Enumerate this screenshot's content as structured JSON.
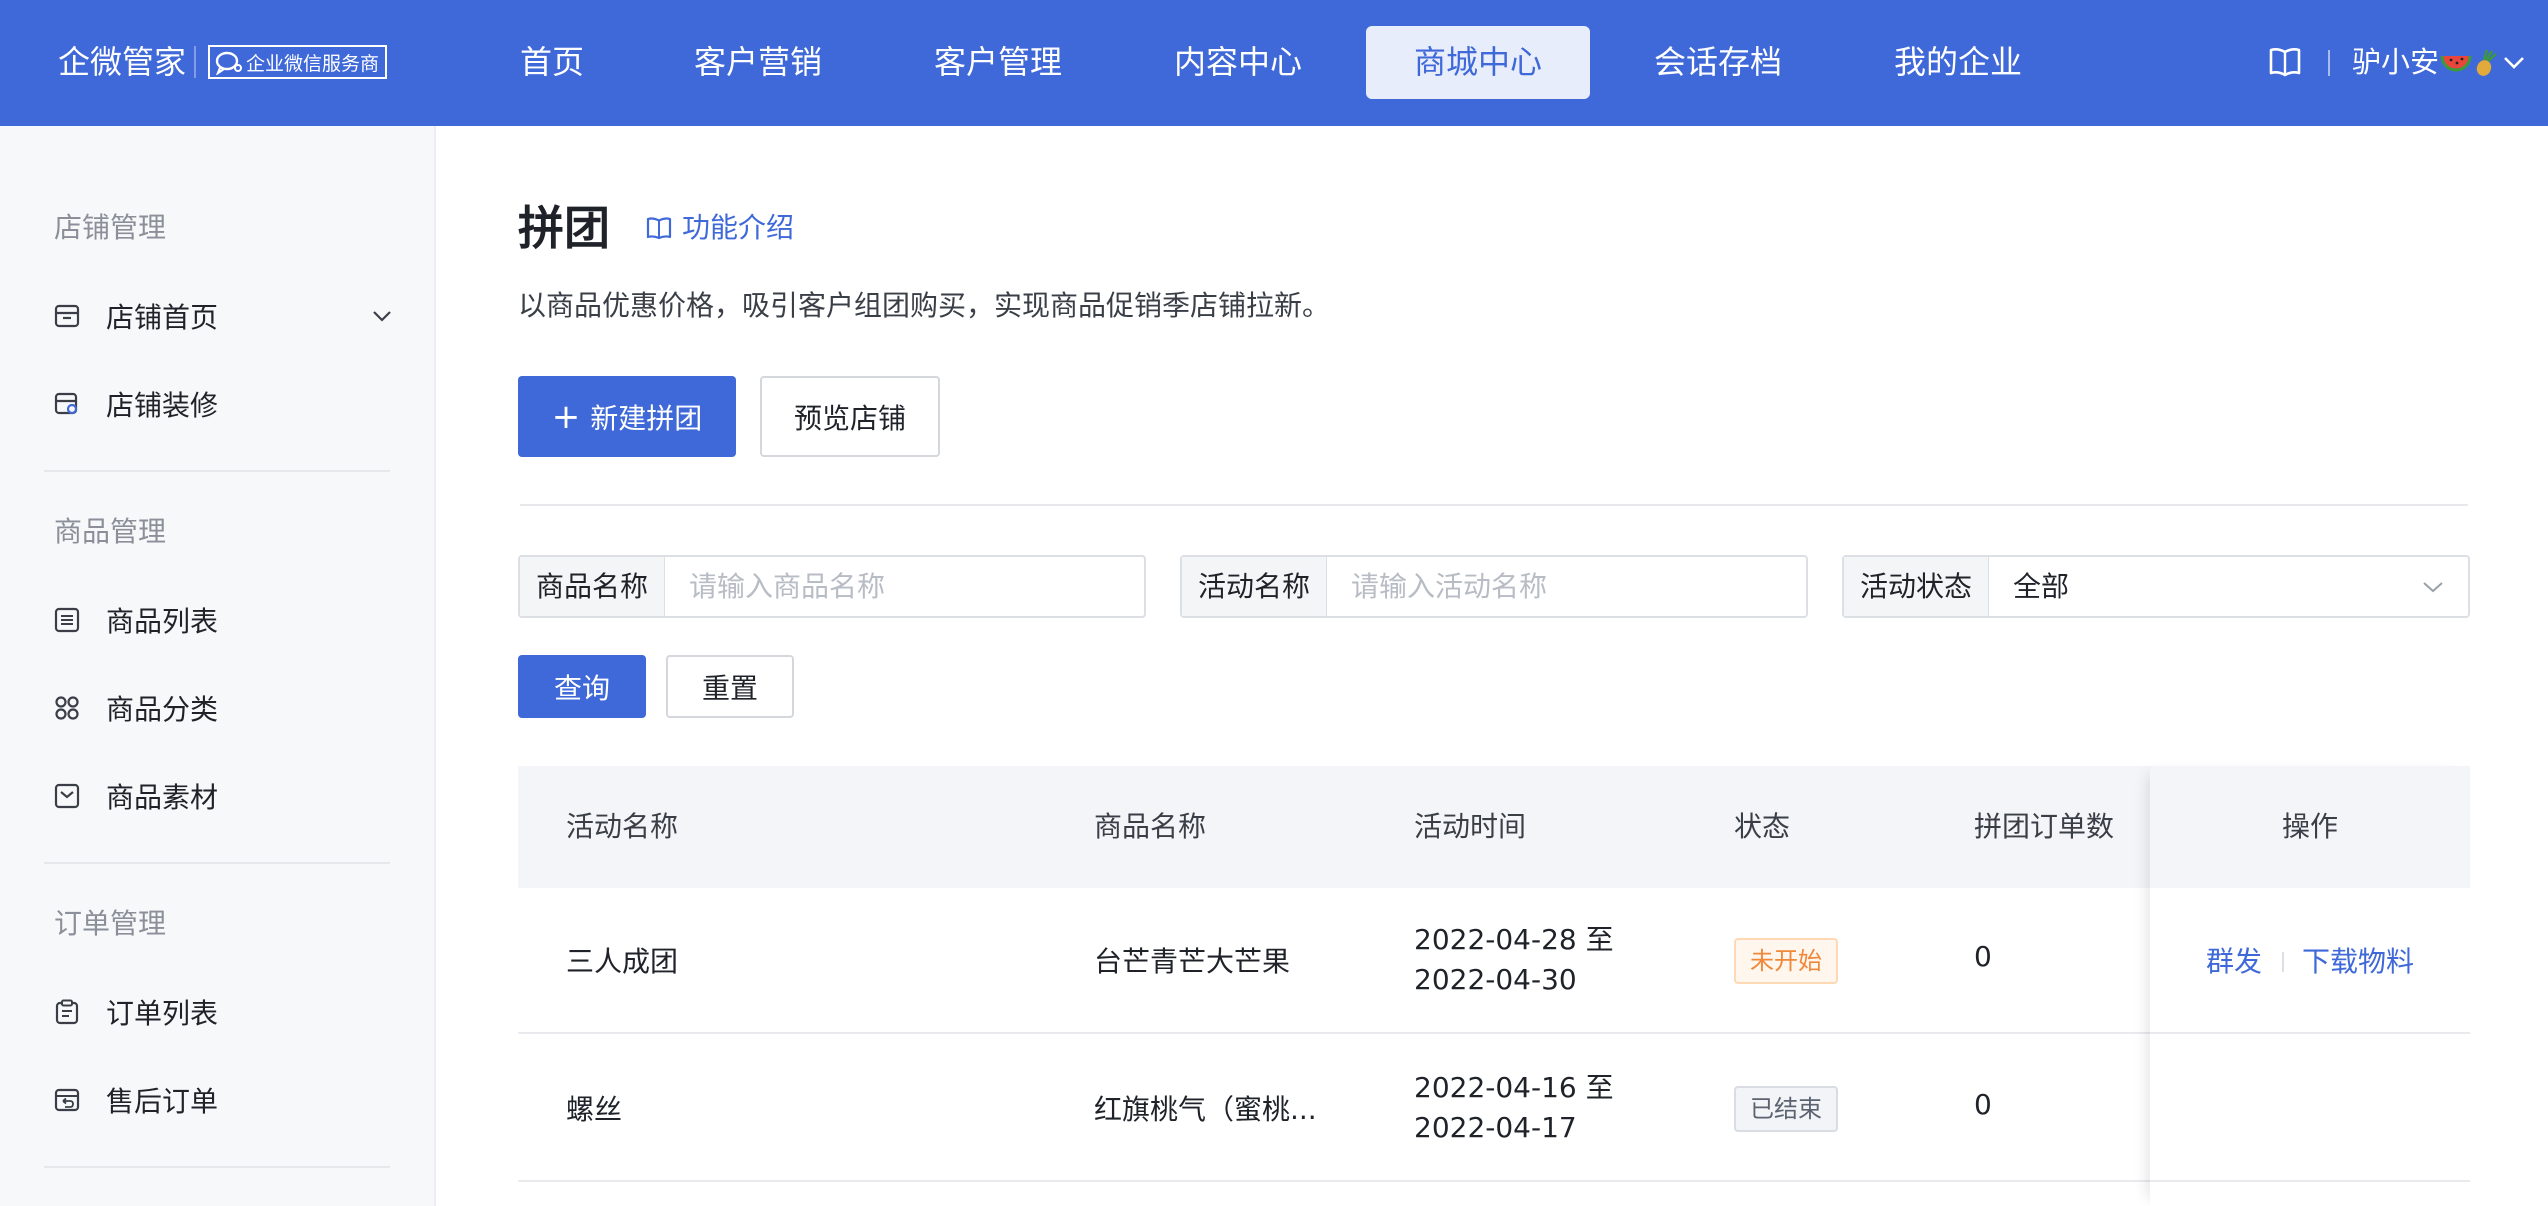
{
  "header": {
    "brand": "企微管家",
    "badge": "企业微信服务商",
    "nav": [
      {
        "label": "首页",
        "active": false
      },
      {
        "label": "客户营销",
        "active": false
      },
      {
        "label": "客户管理",
        "active": false
      },
      {
        "label": "内容中心",
        "active": false
      },
      {
        "label": "商城中心",
        "active": true
      },
      {
        "label": "会话存档",
        "active": false
      },
      {
        "label": "我的企业",
        "active": false
      }
    ],
    "user": "驴小安",
    "user_emoji_icons": [
      "watermelon-icon",
      "pineapple-icon"
    ]
  },
  "sidebar": {
    "groups": [
      {
        "title": "店铺管理",
        "items": [
          {
            "label": "店铺首页",
            "icon": "store-icon",
            "expandable": true
          },
          {
            "label": "店铺装修",
            "icon": "store-decorate-icon"
          }
        ]
      },
      {
        "title": "商品管理",
        "items": [
          {
            "label": "商品列表",
            "icon": "list-icon"
          },
          {
            "label": "商品分类",
            "icon": "category-icon"
          },
          {
            "label": "商品素材",
            "icon": "material-icon"
          }
        ]
      },
      {
        "title": "订单管理",
        "items": [
          {
            "label": "订单列表",
            "icon": "clipboard-icon"
          },
          {
            "label": "售后订单",
            "icon": "return-icon"
          }
        ]
      }
    ]
  },
  "page": {
    "title": "拼团",
    "feature_link": "功能介绍",
    "description": "以商品优惠价格，吸引客户组团购买，实现商品促销季店铺拉新。",
    "new_button": "新建拼团",
    "preview_button": "预览店铺"
  },
  "filters": {
    "product_label": "商品名称",
    "product_placeholder": "请输入商品名称",
    "activity_label": "活动名称",
    "activity_placeholder": "请输入活动名称",
    "status_label": "活动状态",
    "status_value": "全部",
    "search_button": "查询",
    "reset_button": "重置"
  },
  "table": {
    "columns": [
      "活动名称",
      "商品名称",
      "活动时间",
      "状态",
      "拼团订单数",
      "操作"
    ],
    "rows": [
      {
        "activity": "三人成团",
        "product": "台芒青芒大芒果",
        "time_start": "2022-04-28 至",
        "time_end": "2022-04-30",
        "status": "未开始",
        "orders": "0",
        "actions": [
          "群发",
          "下载物料"
        ]
      },
      {
        "activity": "螺丝",
        "product": "红旗桃气（蜜桃...",
        "time_start": "2022-04-16 至",
        "time_end": "2022-04-17",
        "status": "已结束",
        "orders": "0",
        "actions": []
      }
    ]
  },
  "colors": {
    "primary": "#3f68d8",
    "pending": "#f0883a",
    "ended": "#5b6270"
  }
}
